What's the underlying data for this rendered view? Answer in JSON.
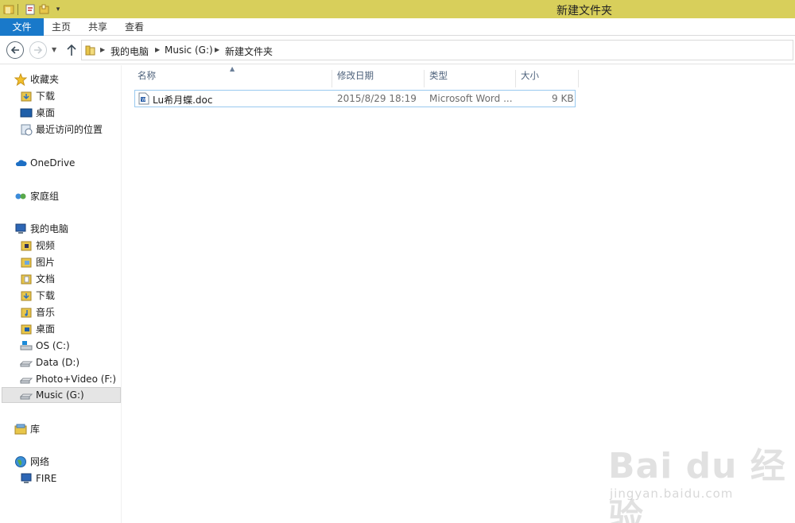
{
  "window": {
    "title": "新建文件夹"
  },
  "ribbon": {
    "tabs": [
      "文件",
      "主页",
      "共享",
      "查看"
    ]
  },
  "address": {
    "crumbs": [
      "我的电脑",
      "Music (G:)",
      "新建文件夹"
    ]
  },
  "sidebar": {
    "favorites": {
      "label": "收藏夹",
      "items": [
        "下载",
        "桌面",
        "最近访问的位置"
      ]
    },
    "onedrive": "OneDrive",
    "homegroup": "家庭组",
    "pc": {
      "label": "我的电脑",
      "items": [
        "视频",
        "图片",
        "文档",
        "下载",
        "音乐",
        "桌面",
        "OS (C:)",
        "Data (D:)",
        "Photo+Video (F:)",
        "Music (G:)"
      ]
    },
    "libraries": "库",
    "network": {
      "label": "网络",
      "items": [
        "FIRE"
      ]
    }
  },
  "columns": [
    "名称",
    "修改日期",
    "类型",
    "大小"
  ],
  "files": [
    {
      "name": "Lu希月蝶.doc",
      "modified": "2015/8/29 18:19",
      "type": "Microsoft Word ...",
      "size": "9 KB"
    }
  ],
  "watermark": {
    "logo": "Bai du 经验",
    "url": "jingyan.baidu.com"
  },
  "colors": {
    "titlebar": "#d8cf5b",
    "file_tab": "#1979ca",
    "selection_border": "#99c9ef"
  }
}
